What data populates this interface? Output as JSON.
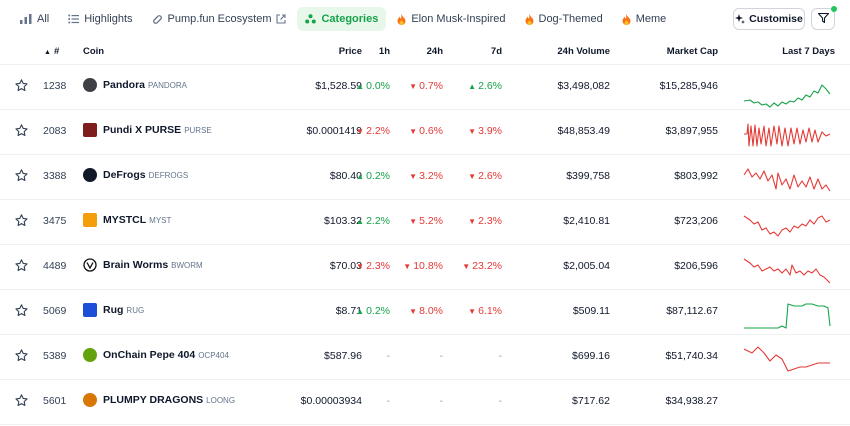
{
  "tabs": [
    {
      "label": "All",
      "icon": "bar-chart-icon",
      "active": false
    },
    {
      "label": "Highlights",
      "icon": "list-icon",
      "active": false
    },
    {
      "label": "Pump.fun Ecosystem",
      "icon": "pill-icon",
      "active": false
    },
    {
      "label": "Categories",
      "icon": "category-icon",
      "active": true
    },
    {
      "label": "Elon Musk-Inspired",
      "icon": "fire-icon",
      "active": false
    },
    {
      "label": "Dog-Themed",
      "icon": "fire-icon",
      "active": false
    },
    {
      "label": "Meme",
      "icon": "fire-icon",
      "active": false
    }
  ],
  "toolbar": {
    "customise_label": "Customise"
  },
  "colors": {
    "accent": "#16a34a",
    "accent_bg": "#e7f8ea",
    "up": "#16a34a",
    "down": "#e53935"
  },
  "table": {
    "headers": {
      "rank": "#",
      "coin": "Coin",
      "price": "Price",
      "h1": "1h",
      "h24": "24h",
      "d7": "7d",
      "volume": "24h Volume",
      "mcap": "Market Cap",
      "last7": "Last 7 Days"
    },
    "rows": [
      {
        "rank": "1238",
        "name": "Pandora",
        "symbol": "PANDORA",
        "price": "$1,528.59",
        "h1": "0.0%",
        "h1_dir": "up",
        "h24": "0.7%",
        "h24_dir": "down",
        "d7": "2.6%",
        "d7_dir": "up",
        "volume": "$3,498,082",
        "mcap": "$15,285,946",
        "trend": "up"
      },
      {
        "rank": "2083",
        "name": "Pundi X PURSE",
        "symbol": "PURSE",
        "price": "$0.0001419",
        "h1": "2.2%",
        "h1_dir": "down",
        "h24": "0.6%",
        "h24_dir": "down",
        "d7": "3.9%",
        "d7_dir": "down",
        "volume": "$48,853.49",
        "mcap": "$3,897,955",
        "trend": "down"
      },
      {
        "rank": "3388",
        "name": "DeFrogs",
        "symbol": "DEFROGS",
        "price": "$80.40",
        "h1": "0.2%",
        "h1_dir": "up",
        "h24": "3.2%",
        "h24_dir": "down",
        "d7": "2.6%",
        "d7_dir": "down",
        "volume": "$399,758",
        "mcap": "$803,992",
        "trend": "down"
      },
      {
        "rank": "3475",
        "name": "MYSTCL",
        "symbol": "MYST",
        "price": "$103.32",
        "h1": "2.2%",
        "h1_dir": "up",
        "h24": "5.2%",
        "h24_dir": "down",
        "d7": "2.3%",
        "d7_dir": "down",
        "volume": "$2,410.81",
        "mcap": "$723,206",
        "trend": "down"
      },
      {
        "rank": "4489",
        "name": "Brain Worms",
        "symbol": "BWORM",
        "price": "$70.03",
        "h1": "2.3%",
        "h1_dir": "down",
        "h24": "10.8%",
        "h24_dir": "down",
        "d7": "23.2%",
        "d7_dir": "down",
        "volume": "$2,005.04",
        "mcap": "$206,596",
        "trend": "down"
      },
      {
        "rank": "5069",
        "name": "Rug",
        "symbol": "RUG",
        "price": "$8.71",
        "h1": "0.2%",
        "h1_dir": "up",
        "h24": "8.0%",
        "h24_dir": "down",
        "d7": "6.1%",
        "d7_dir": "down",
        "volume": "$509.11",
        "mcap": "$87,112.67",
        "trend": "up"
      },
      {
        "rank": "5389",
        "name": "OnChain Pepe 404",
        "symbol": "OCP404",
        "price": "$587.96",
        "h1": "-",
        "h1_dir": "none",
        "h24": "-",
        "h24_dir": "none",
        "d7": "-",
        "d7_dir": "none",
        "volume": "$699.16",
        "mcap": "$51,740.34",
        "trend": "down"
      },
      {
        "rank": "5601",
        "name": "PLUMPY DRAGONS",
        "symbol": "LOONG",
        "price": "$0.00003934",
        "h1": "-",
        "h1_dir": "none",
        "h24": "-",
        "h24_dir": "none",
        "d7": "-",
        "d7_dir": "none",
        "volume": "$717.62",
        "mcap": "$34,938.27",
        "trend": "none"
      }
    ]
  }
}
